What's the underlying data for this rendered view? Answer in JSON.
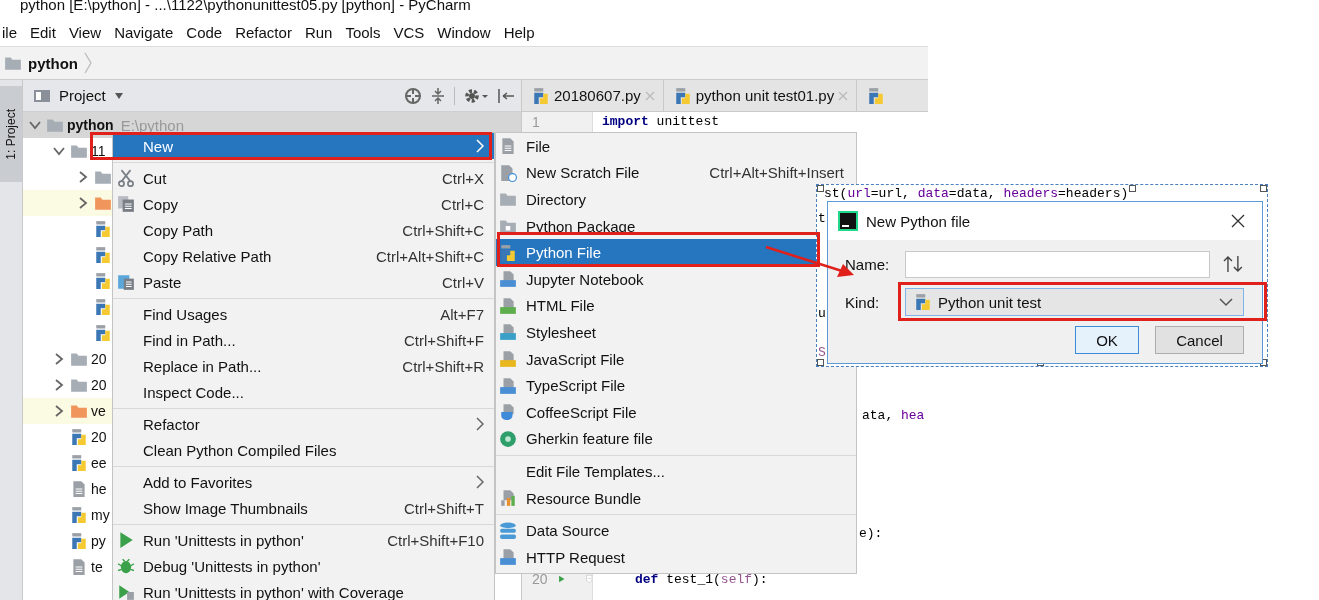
{
  "window": {
    "title": "python [E:\\python] - ...\\1122\\pythonunittest05.py [python] - PyCharm"
  },
  "menu_bar": [
    "ile",
    "Edit",
    "View",
    "Navigate",
    "Code",
    "Refactor",
    "Run",
    "Tools",
    "VCS",
    "Window",
    "Help"
  ],
  "breadcrumb": "python",
  "tool_strip": {
    "label": "1: Project"
  },
  "project_panel": {
    "title": "Project",
    "tree": [
      {
        "label": "python",
        "path": "E:\\python",
        "kind": "folder",
        "expanded": true,
        "selected": true,
        "children": [
          {
            "label": "11",
            "kind": "folder",
            "expanded": true,
            "selected": false,
            "children": [
              {
                "kind": "folder",
                "expanded": false,
                "selected": false
              },
              {
                "kind": "excluded_folder",
                "expanded": false,
                "selected": false
              },
              {
                "kind": "python",
                "selected": false
              },
              {
                "kind": "python",
                "selected": false
              },
              {
                "kind": "python",
                "selected": false
              },
              {
                "kind": "python",
                "selected": false
              },
              {
                "kind": "python",
                "selected": false
              }
            ]
          },
          {
            "label": "20",
            "kind": "folder",
            "expanded": false,
            "selected": false
          },
          {
            "label": "20",
            "kind": "folder",
            "expanded": false,
            "selected": false
          },
          {
            "label": "ve",
            "kind": "excluded_folder",
            "expanded": false,
            "selected": false
          },
          {
            "label": "20",
            "kind": "python",
            "selected": false
          },
          {
            "label": "ee",
            "kind": "python",
            "selected": false
          },
          {
            "label": "he",
            "kind": "text",
            "selected": false
          },
          {
            "label": "my",
            "kind": "python",
            "selected": false
          },
          {
            "label": "py",
            "kind": "python",
            "selected": false
          },
          {
            "label": "te",
            "kind": "text",
            "selected": false
          }
        ]
      }
    ]
  },
  "editor": {
    "tabs": [
      {
        "label": "20180607.py",
        "selected": false
      },
      {
        "label": "python unit test01.py",
        "selected": false
      }
    ],
    "lines": [
      {
        "number": "1",
        "segments": [
          {
            "text": "import",
            "kind": "keyword"
          },
          {
            "text": " unittest",
            "kind": "plain"
          }
        ]
      },
      {
        "segments": [
          {
            "text": "ata, ",
            "kind": "plain"
          },
          {
            "text": "hea",
            "kind": "arg"
          }
        ]
      },
      {
        "segments": [
          {
            "text": "e):",
            "kind": "plain"
          }
        ]
      },
      {
        "number": "20",
        "runnable": true,
        "segments": [
          {
            "text": "def",
            "kind": "keyword"
          },
          {
            "text": " test_1(",
            "kind": "plain"
          },
          {
            "text": "self",
            "kind": "self"
          },
          {
            "text": "):",
            "kind": "plain"
          }
        ]
      }
    ]
  },
  "context_menu": [
    {
      "kind": "item",
      "label": "New",
      "has_submenu": true,
      "selected": true
    },
    {
      "kind": "separator"
    },
    {
      "kind": "item",
      "label": "Cut",
      "shortcut": "Ctrl+X",
      "has_submenu": false,
      "selected": false
    },
    {
      "kind": "item",
      "label": "Copy",
      "shortcut": "Ctrl+C",
      "has_submenu": false,
      "selected": false
    },
    {
      "kind": "item",
      "label": "Copy Path",
      "shortcut": "Ctrl+Shift+C",
      "has_submenu": false,
      "selected": false
    },
    {
      "kind": "item",
      "label": "Copy Relative Path",
      "shortcut": "Ctrl+Alt+Shift+C",
      "has_submenu": false,
      "selected": false
    },
    {
      "kind": "item",
      "label": "Paste",
      "shortcut": "Ctrl+V",
      "has_submenu": false,
      "selected": false
    },
    {
      "kind": "separator"
    },
    {
      "kind": "item",
      "label": "Find Usages",
      "shortcut": "Alt+F7",
      "has_submenu": false,
      "selected": false
    },
    {
      "kind": "item",
      "label": "Find in Path...",
      "shortcut": "Ctrl+Shift+F",
      "has_submenu": false,
      "selected": false
    },
    {
      "kind": "item",
      "label": "Replace in Path...",
      "shortcut": "Ctrl+Shift+R",
      "has_submenu": false,
      "selected": false
    },
    {
      "kind": "item",
      "label": "Inspect Code...",
      "has_submenu": false,
      "selected": false
    },
    {
      "kind": "separator"
    },
    {
      "kind": "item",
      "label": "Refactor",
      "has_submenu": true,
      "selected": false
    },
    {
      "kind": "item",
      "label": "Clean Python Compiled Files",
      "has_submenu": false,
      "selected": false
    },
    {
      "kind": "separator"
    },
    {
      "kind": "item",
      "label": "Add to Favorites",
      "has_submenu": true,
      "selected": false
    },
    {
      "kind": "item",
      "label": "Show Image Thumbnails",
      "shortcut": "Ctrl+Shift+T",
      "has_submenu": false,
      "selected": false
    },
    {
      "kind": "separator"
    },
    {
      "kind": "item",
      "label": "Run 'Unittests in python'",
      "shortcut": "Ctrl+Shift+F10",
      "has_submenu": false,
      "selected": false
    },
    {
      "kind": "item",
      "label": "Debug 'Unittests in python'",
      "has_submenu": false,
      "selected": false
    },
    {
      "kind": "item",
      "label": "Run 'Unittests in python' with Coverage",
      "has_submenu": false,
      "selected": false
    }
  ],
  "new_submenu": [
    {
      "kind": "item",
      "label": "File",
      "selected": false
    },
    {
      "kind": "item",
      "label": "New Scratch File",
      "shortcut": "Ctrl+Alt+Shift+Insert",
      "selected": false
    },
    {
      "kind": "item",
      "label": "Directory",
      "selected": false
    },
    {
      "kind": "item",
      "label": "Python Package",
      "selected": false
    },
    {
      "kind": "item",
      "label": "Python File",
      "selected": true
    },
    {
      "kind": "item",
      "label": "Jupyter Notebook",
      "selected": false
    },
    {
      "kind": "item",
      "label": "HTML File",
      "selected": false
    },
    {
      "kind": "item",
      "label": "Stylesheet",
      "selected": false
    },
    {
      "kind": "item",
      "label": "JavaScript File",
      "selected": false
    },
    {
      "kind": "item",
      "label": "TypeScript File",
      "selected": false
    },
    {
      "kind": "item",
      "label": "CoffeeScript File",
      "selected": false
    },
    {
      "kind": "item",
      "label": "Gherkin feature file",
      "selected": false
    },
    {
      "kind": "separator"
    },
    {
      "kind": "item",
      "label": "Edit File Templates...",
      "selected": false
    },
    {
      "kind": "item",
      "label": "Resource Bundle",
      "selected": false
    },
    {
      "kind": "separator"
    },
    {
      "kind": "item",
      "label": "Data Source",
      "selected": false
    },
    {
      "kind": "item",
      "label": "HTTP Request",
      "selected": false
    }
  ],
  "capture": {
    "lines": [
      {
        "segments": [
          {
            "text": "st(",
            "kind": "plain"
          },
          {
            "text": "url",
            "kind": "arg"
          },
          {
            "text": "=url, ",
            "kind": "plain"
          },
          {
            "text": "data",
            "kind": "arg"
          },
          {
            "text": "=data, ",
            "kind": "plain"
          },
          {
            "text": "headers",
            "kind": "arg"
          },
          {
            "text": "=headers)",
            "kind": "plain"
          }
        ]
      },
      {
        "segments": [
          {
            "text": "t",
            "kind": "plain"
          }
        ]
      },
      {
        "segments": [
          {
            "text": "u",
            "kind": "plain"
          }
        ]
      },
      {
        "segments": [
          {
            "text": "S",
            "kind": "self"
          }
        ]
      }
    ]
  },
  "dialog": {
    "title": "New Python file",
    "name_label": "Name:",
    "kind_label": "Kind:",
    "kind_value": "Python unit test",
    "buttons": [
      {
        "label": "OK",
        "default": true
      },
      {
        "label": "Cancel",
        "default": false
      }
    ]
  }
}
